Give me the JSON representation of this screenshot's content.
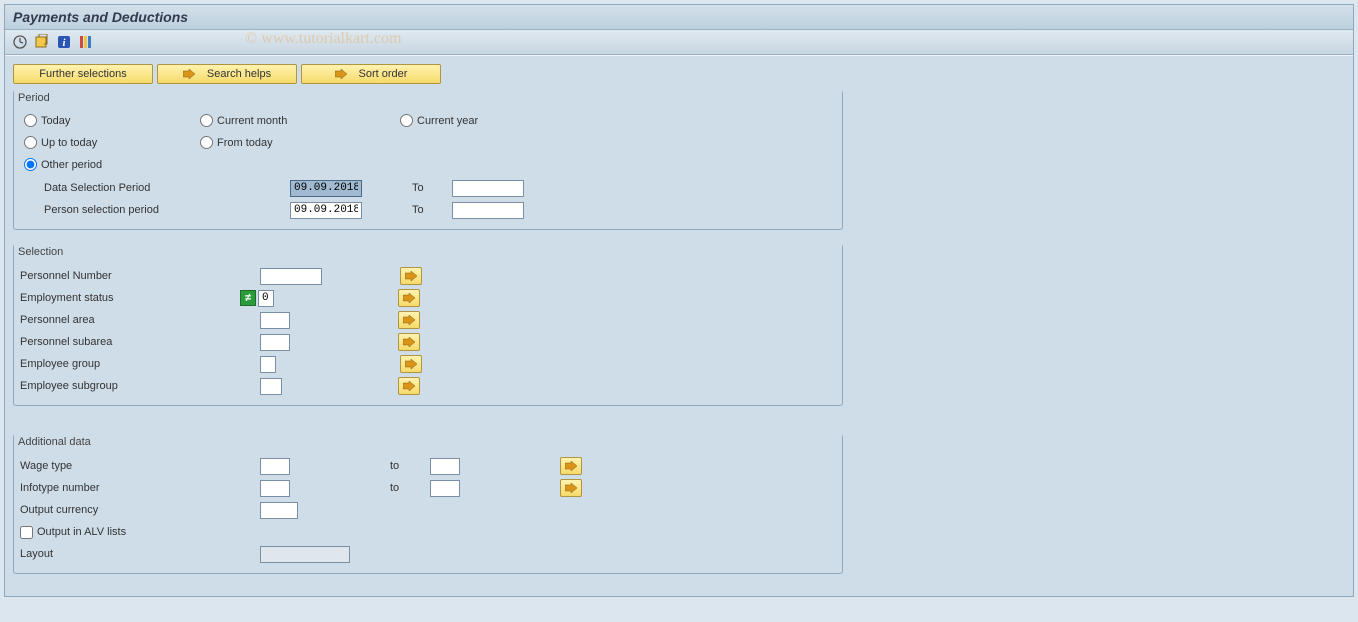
{
  "title": "Payments and Deductions",
  "watermark": "© www.tutorialkart.com",
  "buttons": {
    "further_selections": "Further selections",
    "search_helps": "Search helps",
    "sort_order": "Sort order"
  },
  "groups": {
    "period": {
      "title": "Period",
      "radios": {
        "today": "Today",
        "current_month": "Current month",
        "current_year": "Current year",
        "up_to_today": "Up to today",
        "from_today": "From today",
        "other_period": "Other period"
      },
      "data_selection_label": "Data Selection Period",
      "data_selection_from": "09.09.2018",
      "data_selection_to_label": "To",
      "data_selection_to": "",
      "person_selection_label": "Person selection period",
      "person_selection_from": "09.09.2018",
      "person_selection_to_label": "To",
      "person_selection_to": ""
    },
    "selection": {
      "title": "Selection",
      "personnel_number": "Personnel Number",
      "personnel_number_val": "",
      "employment_status": "Employment status",
      "employment_status_val": "0",
      "personnel_area": "Personnel area",
      "personnel_area_val": "",
      "personnel_subarea": "Personnel subarea",
      "personnel_subarea_val": "",
      "employee_group": "Employee group",
      "employee_group_val": "",
      "employee_subgroup": "Employee subgroup",
      "employee_subgroup_val": ""
    },
    "additional": {
      "title": "Additional data",
      "wage_type": "Wage type",
      "wage_type_from": "",
      "wage_type_to_label": "to",
      "wage_type_to": "",
      "infotype_number": "Infotype number",
      "infotype_from": "",
      "infotype_to_label": "to",
      "infotype_to": "",
      "output_currency": "Output currency",
      "output_currency_val": "",
      "alv_label": "Output in ALV lists",
      "layout": "Layout",
      "layout_val": ""
    }
  }
}
